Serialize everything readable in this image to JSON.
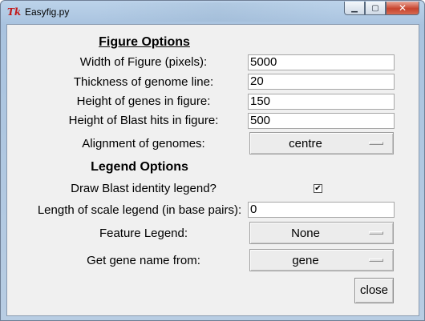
{
  "window": {
    "title": "Easyfig.py",
    "app_icon": "Tk",
    "controls": {
      "minimize_icon": "▁",
      "maximize_icon": "▢",
      "close_icon": "✕"
    }
  },
  "figure_options": {
    "heading": "Figure Options",
    "width_label": "Width of Figure (pixels):",
    "width_value": "5000",
    "thickness_label": "Thickness of genome line:",
    "thickness_value": "20",
    "gene_height_label": "Height of genes in figure:",
    "gene_height_value": "150",
    "blast_height_label": "Height of Blast hits in figure:",
    "blast_height_value": "500",
    "alignment_label": "Alignment of genomes:",
    "alignment_value": "centre"
  },
  "legend_options": {
    "heading": "Legend Options",
    "blast_legend_label": "Draw Blast identity legend?",
    "blast_legend_checked": true,
    "blast_legend_mark": "✔",
    "scale_label": "Length of scale legend (in base pairs):",
    "scale_value": "0",
    "feature_label": "Feature Legend:",
    "feature_value": "None",
    "gene_name_label": "Get gene name from:",
    "gene_name_value": "gene"
  },
  "buttons": {
    "close_label": "close"
  }
}
